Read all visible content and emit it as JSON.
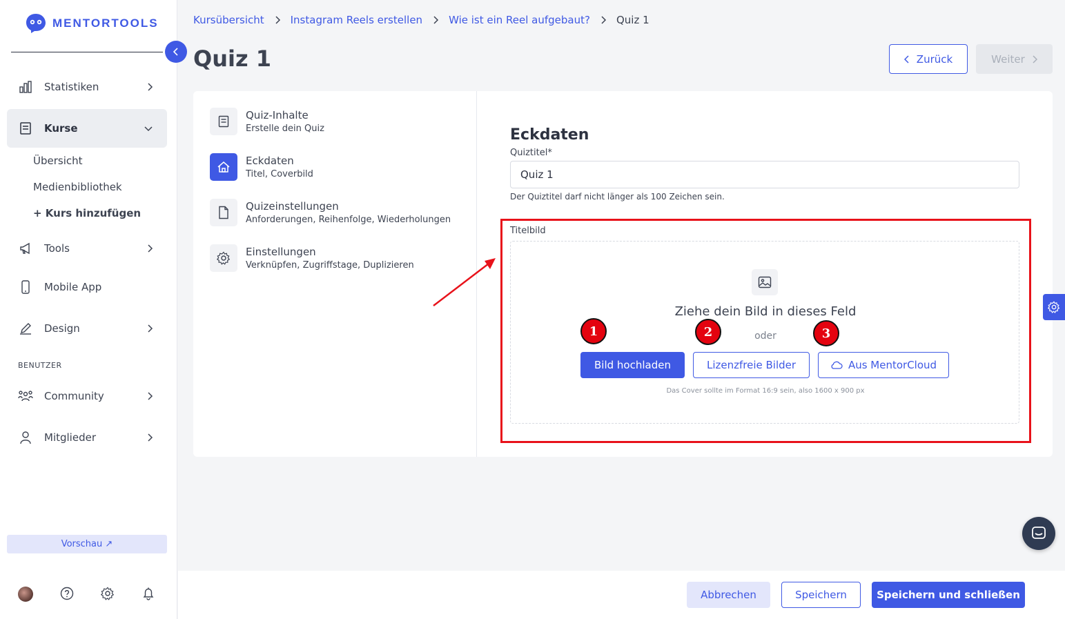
{
  "brand": {
    "name": "MENTORTOOLS",
    "accent": "#3f59e4"
  },
  "sidebar": {
    "items": [
      {
        "label": "Statistiken",
        "icon": "bar-chart-icon"
      },
      {
        "label": "Kurse",
        "icon": "book-icon",
        "expanded": true
      },
      {
        "label": "Tools",
        "icon": "megaphone-icon"
      },
      {
        "label": "Mobile App",
        "icon": "phone-icon"
      },
      {
        "label": "Design",
        "icon": "pencil-icon"
      },
      {
        "label": "Community",
        "icon": "people-icon"
      },
      {
        "label": "Mitglieder",
        "icon": "user-icon"
      }
    ],
    "sub_items": [
      "Übersicht",
      "Medienbibliothek",
      "+ Kurs hinzufügen"
    ],
    "section_label": "BENUTZER",
    "preview_label": "Vorschau ↗"
  },
  "breadcrumb": [
    "Kursübersicht",
    "Instagram Reels erstellen",
    "Wie ist ein Reel aufgebaut?",
    "Quiz 1"
  ],
  "page": {
    "title": "Quiz 1",
    "back_label": "Zurück",
    "next_label": "Weiter"
  },
  "steps": [
    {
      "title": "Quiz-Inhalte",
      "subtitle": "Erstelle dein Quiz",
      "icon": "book-icon"
    },
    {
      "title": "Eckdaten",
      "subtitle": "Titel, Coverbild",
      "icon": "home-icon",
      "active": true
    },
    {
      "title": "Quizeinstellungen",
      "subtitle": "Anforderungen, Reihenfolge, Wiederholungen",
      "icon": "file-icon"
    },
    {
      "title": "Einstellungen",
      "subtitle": "Verknüpfen, Zugriffstage, Duplizieren",
      "icon": "gear-icon"
    }
  ],
  "form": {
    "heading": "Eckdaten",
    "title_label": "Quiztitel*",
    "title_value": "Quiz 1",
    "title_hint": "Der Quiztitel darf nicht länger als 100 Zeichen sein.",
    "cover_label": "Titelbild",
    "drop_text": "Ziehe dein Bild in dieses Feld",
    "or_text": "oder",
    "upload_label": "Bild hochladen",
    "free_images_label": "Lizenzfreie Bilder",
    "cloud_label": "Aus MentorCloud",
    "format_note": "Das Cover sollte im Format 16:9 sein, also 1600 x 900 px"
  },
  "annotations": {
    "badges": [
      "1",
      "2",
      "3"
    ],
    "highlight_color": "#e8121a"
  },
  "footer": {
    "cancel_label": "Abbrechen",
    "save_label": "Speichern",
    "save_close_label": "Speichern und schließen"
  }
}
